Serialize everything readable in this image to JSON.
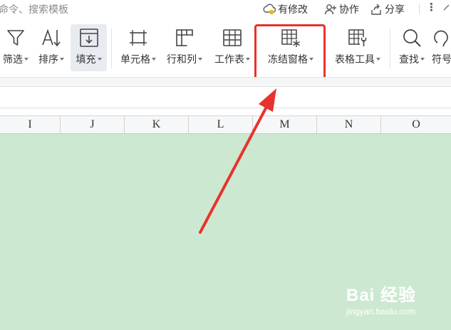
{
  "topbar": {
    "search_hint": "命令、搜索模板",
    "unsaved_label": "有修改",
    "collab_label": "协作",
    "share_label": "分享",
    "more_label": "⋮"
  },
  "ribbon": {
    "items": [
      {
        "label": "筛选",
        "icon": "filter-icon"
      },
      {
        "label": "排序",
        "icon": "sort-icon"
      },
      {
        "label": "填充",
        "icon": "fill-icon"
      },
      {
        "label": "单元格",
        "icon": "cell-icon"
      },
      {
        "label": "行和列",
        "icon": "rows-columns-icon"
      },
      {
        "label": "工作表",
        "icon": "worksheet-icon"
      },
      {
        "label": "冻结窗格",
        "icon": "freeze-panes-icon"
      },
      {
        "label": "表格工具",
        "icon": "table-tools-icon"
      },
      {
        "label": "查找",
        "icon": "find-icon"
      },
      {
        "label": "符号",
        "icon": "symbol-icon"
      }
    ]
  },
  "columns": [
    "I",
    "J",
    "K",
    "L",
    "M",
    "N",
    "O"
  ],
  "annotation": {
    "highlight_color": "#e8322b",
    "highlighted_item": "冻结窗格"
  },
  "watermark": {
    "brand": "Bai 经验",
    "site": "jingyan.baidu.com"
  },
  "colors": {
    "grid_background": "#cde8d0",
    "header_background": "#f6f7f8",
    "accent_red": "#e8322b"
  }
}
